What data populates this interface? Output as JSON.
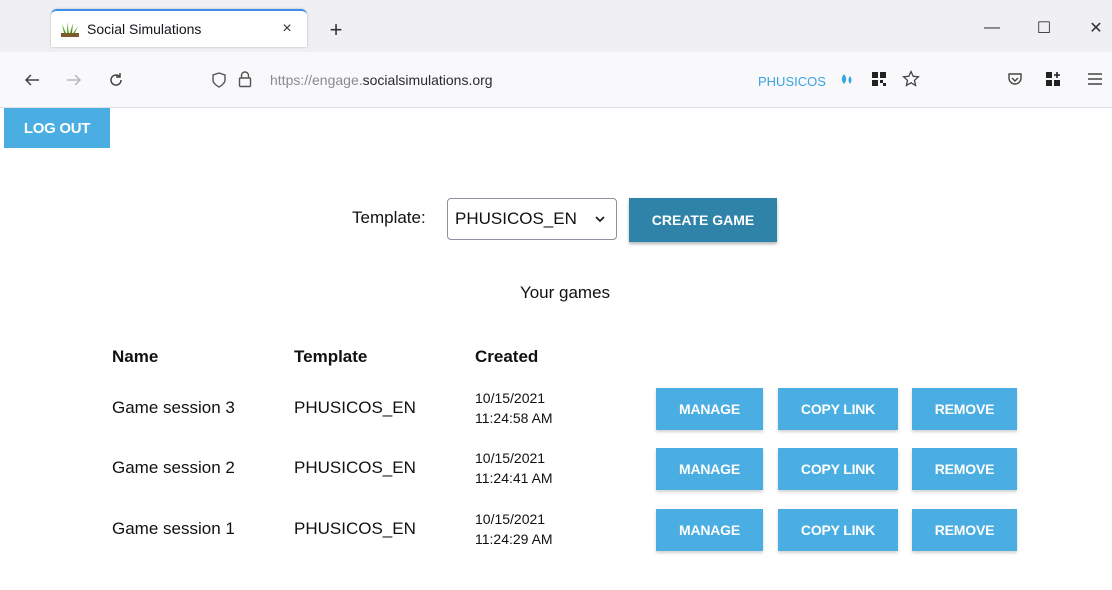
{
  "browser": {
    "tab_title": "Social Simulations",
    "tab_close": "×",
    "new_tab": "+",
    "window_controls": {
      "minimize": "—",
      "maximize": "☐",
      "close": "✕"
    },
    "url_prefix": "https://engage.",
    "url_domain": "socialsimulations.org",
    "extension_label": "PHUSICOS",
    "accent_color": "#3aa3e0"
  },
  "page": {
    "logout_label": "LOG OUT",
    "template_label": "Template:",
    "template_selected": "PHUSICOS_EN",
    "create_game_label": "CREATE GAME",
    "games_title": "Your games",
    "columns": {
      "name": "Name",
      "template": "Template",
      "created": "Created"
    },
    "games": [
      {
        "name": "Game session 3",
        "template": "PHUSICOS_EN",
        "date": "10/15/2021",
        "time": "11:24:58 AM",
        "manage": "MANAGE",
        "copy": "COPY LINK",
        "remove": "REMOVE"
      },
      {
        "name": "Game session 2",
        "template": "PHUSICOS_EN",
        "date": "10/15/2021",
        "time": "11:24:41 AM",
        "manage": "MANAGE",
        "copy": "COPY LINK",
        "remove": "REMOVE"
      },
      {
        "name": "Game session 1",
        "template": "PHUSICOS_EN",
        "date": "10/15/2021",
        "time": "11:24:29 AM",
        "manage": "MANAGE",
        "copy": "COPY LINK",
        "remove": "REMOVE"
      }
    ],
    "button_color": "#4aaee2",
    "primary_color": "#2f82a8"
  }
}
